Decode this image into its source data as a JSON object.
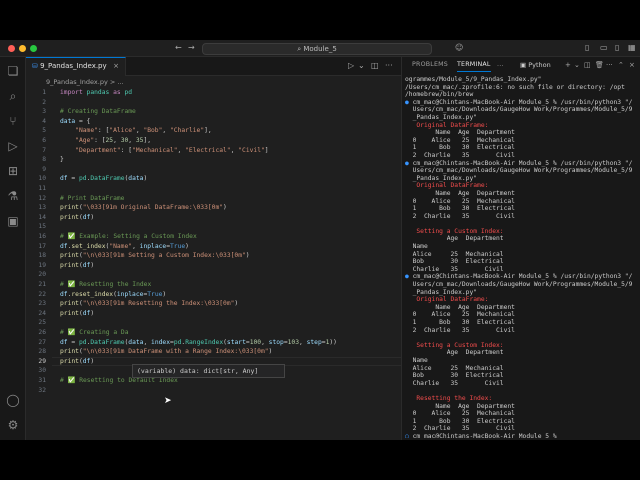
{
  "titlebar": {
    "search_text": "Module_5"
  },
  "editor": {
    "tab_label": "9_Pandas_Index.py",
    "breadcrumb": "9_Pandas_Index.py > ...",
    "tooltip": "(variable) data: dict[str, Any]"
  },
  "code": [
    {
      "n": "1",
      "html": "<span class=\"kw\">import</span> <span class=\"cls\">pandas</span> <span class=\"kw\">as</span> <span class=\"cls\">pd</span>"
    },
    {
      "n": "2",
      "html": ""
    },
    {
      "n": "3",
      "html": "<span class=\"cm\"># Creating DataFrame</span>"
    },
    {
      "n": "4",
      "html": "<span class=\"var\">data</span> = {"
    },
    {
      "n": "5",
      "html": "    <span class=\"str\">\"Name\"</span>: [<span class=\"str\">\"Alice\"</span>, <span class=\"str\">\"Bob\"</span>, <span class=\"str\">\"Charlie\"</span>],"
    },
    {
      "n": "6",
      "html": "    <span class=\"str\">\"Age\"</span>: [<span class=\"num\">25</span>, <span class=\"num\">30</span>, <span class=\"num\">35</span>],"
    },
    {
      "n": "7",
      "html": "    <span class=\"str\">\"Department\"</span>: [<span class=\"str\">\"Mechanical\"</span>, <span class=\"str\">\"Electrical\"</span>, <span class=\"str\">\"Civil\"</span>]"
    },
    {
      "n": "8",
      "html": "}"
    },
    {
      "n": "9",
      "html": ""
    },
    {
      "n": "10",
      "html": "<span class=\"var\">df</span> = <span class=\"cls\">pd</span>.<span class=\"cls\">DataFrame</span>(<span class=\"var\">data</span>)"
    },
    {
      "n": "11",
      "html": ""
    },
    {
      "n": "12",
      "html": "<span class=\"cm\"># Print DataFrame</span>"
    },
    {
      "n": "13",
      "html": "<span class=\"fn\">print</span>(<span class=\"str\">\"\\033[91m Original DataFrame:\\033[0m\"</span>)"
    },
    {
      "n": "14",
      "html": "<span class=\"fn\">print</span>(<span class=\"var\">df</span>)"
    },
    {
      "n": "15",
      "html": ""
    },
    {
      "n": "16",
      "html": "<span class=\"cm\"># ✅ Example: Setting a Custom Index</span>"
    },
    {
      "n": "17",
      "html": "<span class=\"var\">df</span>.<span class=\"fn\">set_index</span>(<span class=\"str\">\"Name\"</span>, <span class=\"var\">inplace</span>=<span class=\"ky\">True</span>)"
    },
    {
      "n": "18",
      "html": "<span class=\"fn\">print</span>(<span class=\"str\">\"\\n\\033[91m Setting a Custom Index:\\033[0m\"</span>)"
    },
    {
      "n": "19",
      "html": "<span class=\"fn\">print</span>(<span class=\"var\">df</span>)"
    },
    {
      "n": "20",
      "html": ""
    },
    {
      "n": "21",
      "html": "<span class=\"cm\"># ✅ Resetting the Index</span>"
    },
    {
      "n": "22",
      "html": "<span class=\"var\">df</span>.<span class=\"fn\">reset_index</span>(<span class=\"var\">inplace</span>=<span class=\"ky\">True</span>)"
    },
    {
      "n": "23",
      "html": "<span class=\"fn\">print</span>(<span class=\"str\">\"\\n\\033[91m Resetting the Index:\\033[0m\"</span>)"
    },
    {
      "n": "24",
      "html": "<span class=\"fn\">print</span>(<span class=\"var\">df</span>)"
    },
    {
      "n": "25",
      "html": ""
    },
    {
      "n": "26",
      "html": "<span class=\"cm\"># ✅ Creating a Da</span>"
    },
    {
      "n": "27",
      "html": "<span class=\"var\">df</span> = <span class=\"cls\">pd</span>.<span class=\"cls\">DataFrame</span>(<span class=\"var\">data</span>, <span class=\"var\">index</span>=<span class=\"cls\">pd</span>.<span class=\"cls\">RangeIndex</span>(<span class=\"var\">start</span>=<span class=\"num\">100</span>, <span class=\"var\">stop</span>=<span class=\"num\">103</span>, <span class=\"var\">step</span>=<span class=\"num\">1</span>))"
    },
    {
      "n": "28",
      "html": "<span class=\"fn\">print</span>(<span class=\"str\">\"\\n\\033[91m DataFrame with a Range Index:\\033[0m\"</span>)"
    },
    {
      "n": "29",
      "html": "<span class=\"fn\">print</span>(<span class=\"var\">df</span>)"
    },
    {
      "n": "30",
      "html": ""
    },
    {
      "n": "31",
      "html": "<span class=\"cm\"># ✅ Resetting to Default Index</span>"
    },
    {
      "n": "32",
      "html": ""
    }
  ],
  "terminal": {
    "tabs": [
      "PROBLEMS",
      "TERMINAL",
      "..."
    ],
    "shell_label": "Python",
    "lines": [
      {
        "t": "ogrammes/Module_5/9_Pandas_Index.py\"",
        "c": ""
      },
      {
        "t": "/Users/cm_mac/.zprofile:6: no such file or directory: /opt",
        "c": ""
      },
      {
        "t": "/homebrew/bin/brew",
        "c": ""
      },
      {
        "t": "● cm_mac@Chintans-MacBook-Air Module_5 % /usr/bin/python3 \"/",
        "c": "prompt"
      },
      {
        "t": "  Users/cm_mac/Downloads/GaugeHow Work/Programmes/Module_5/9",
        "c": ""
      },
      {
        "t": "  _Pandas_Index.py\"",
        "c": ""
      },
      {
        "t": "   Original DataFrame:",
        "c": "red"
      },
      {
        "t": "        Name  Age  Department",
        "c": ""
      },
      {
        "t": "  0    Alice   25  Mechanical",
        "c": ""
      },
      {
        "t": "  1      Bob   30  Electrical",
        "c": ""
      },
      {
        "t": "  2  Charlie   35       Civil",
        "c": ""
      },
      {
        "t": "● cm_mac@Chintans-MacBook-Air Module_5 % /usr/bin/python3 \"/",
        "c": "prompt"
      },
      {
        "t": "  Users/cm_mac/Downloads/GaugeHow Work/Programmes/Module_5/9",
        "c": ""
      },
      {
        "t": "  _Pandas_Index.py\"",
        "c": ""
      },
      {
        "t": "   Original DataFrame:",
        "c": "red"
      },
      {
        "t": "        Name  Age  Department",
        "c": ""
      },
      {
        "t": "  0    Alice   25  Mechanical",
        "c": ""
      },
      {
        "t": "  1      Bob   30  Electrical",
        "c": ""
      },
      {
        "t": "  2  Charlie   35       Civil",
        "c": ""
      },
      {
        "t": "",
        "c": ""
      },
      {
        "t": "   Setting a Custom Index:",
        "c": "red"
      },
      {
        "t": "           Age  Department",
        "c": ""
      },
      {
        "t": "  Name",
        "c": ""
      },
      {
        "t": "  Alice     25  Mechanical",
        "c": ""
      },
      {
        "t": "  Bob       30  Electrical",
        "c": ""
      },
      {
        "t": "  Charlie   35       Civil",
        "c": ""
      },
      {
        "t": "● cm_mac@Chintans-MacBook-Air Module_5 % /usr/bin/python3 \"/",
        "c": "prompt"
      },
      {
        "t": "  Users/cm_mac/Downloads/GaugeHow Work/Programmes/Module_5/9",
        "c": ""
      },
      {
        "t": "  _Pandas_Index.py\"",
        "c": ""
      },
      {
        "t": "   Original DataFrame:",
        "c": "red"
      },
      {
        "t": "        Name  Age  Department",
        "c": ""
      },
      {
        "t": "  0    Alice   25  Mechanical",
        "c": ""
      },
      {
        "t": "  1      Bob   30  Electrical",
        "c": ""
      },
      {
        "t": "  2  Charlie   35       Civil",
        "c": ""
      },
      {
        "t": "",
        "c": ""
      },
      {
        "t": "   Setting a Custom Index:",
        "c": "red"
      },
      {
        "t": "           Age  Department",
        "c": ""
      },
      {
        "t": "  Name",
        "c": ""
      },
      {
        "t": "  Alice     25  Mechanical",
        "c": ""
      },
      {
        "t": "  Bob       30  Electrical",
        "c": ""
      },
      {
        "t": "  Charlie   35       Civil",
        "c": ""
      },
      {
        "t": "",
        "c": ""
      },
      {
        "t": "   Resetting the Index:",
        "c": "red"
      },
      {
        "t": "        Name  Age  Department",
        "c": ""
      },
      {
        "t": "  0    Alice   25  Mechanical",
        "c": ""
      },
      {
        "t": "  1      Bob   30  Electrical",
        "c": ""
      },
      {
        "t": "  2  Charlie   35       Civil",
        "c": ""
      },
      {
        "t": "○ cm_mac@Chintans-MacBook-Air Module_5 %",
        "c": "prompt"
      }
    ]
  }
}
